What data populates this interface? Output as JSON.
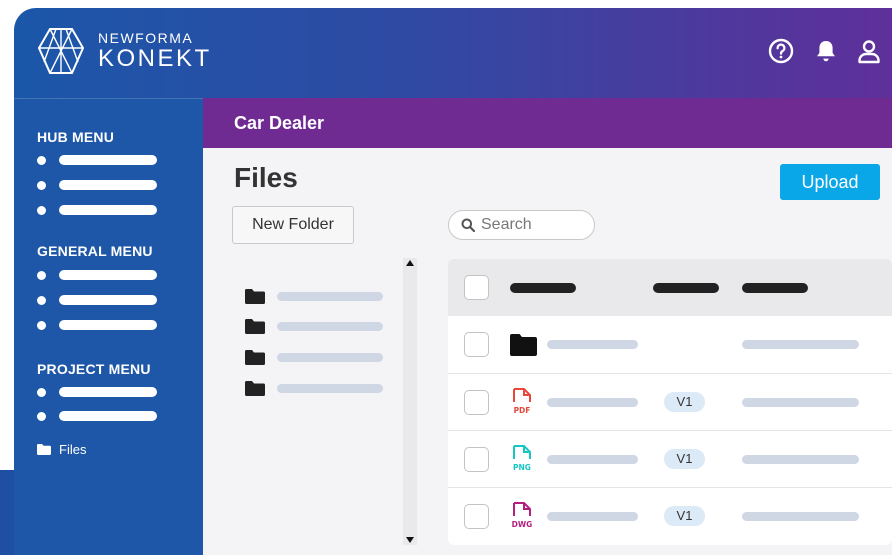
{
  "header": {
    "brand_top": "NEWFORMA",
    "brand_bottom": "KONEKT",
    "icons": [
      "help-icon",
      "bell-icon",
      "user-icon"
    ]
  },
  "sidebar": {
    "hub_menu_title": "HUB MENU",
    "general_menu_title": "GENERAL MENU",
    "project_menu_title": "PROJECT MENU",
    "files_label": "Files"
  },
  "project": {
    "name": "Car Dealer"
  },
  "main": {
    "title": "Files",
    "upload_label": "Upload",
    "new_folder_label": "New Folder",
    "search_placeholder": "Search"
  },
  "table": {
    "rows": [
      {
        "type": "folder",
        "badge": ""
      },
      {
        "type": "PDF",
        "badge": "V1"
      },
      {
        "type": "PNG",
        "badge": "V1"
      },
      {
        "type": "DWG",
        "badge": "V1"
      }
    ]
  },
  "colors": {
    "sidebar": "#1e57a8",
    "project_bar": "#6f2b92",
    "upload": "#0aa7e8",
    "pdf": "#e8483c",
    "png": "#19c7c2",
    "dwg": "#b21f7e"
  }
}
